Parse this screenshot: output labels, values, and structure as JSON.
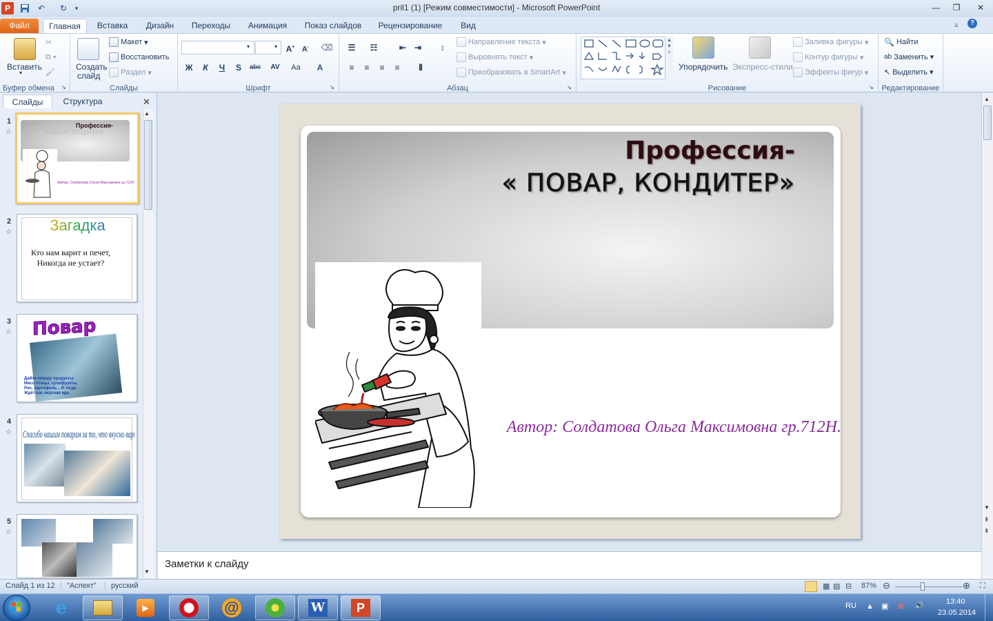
{
  "window": {
    "title": "pril1 (1) [Режим совместимости] - Microsoft PowerPoint"
  },
  "tabs": [
    "Файл",
    "Главная",
    "Вставка",
    "Дизайн",
    "Переходы",
    "Анимация",
    "Показ слайдов",
    "Рецензирование",
    "Вид"
  ],
  "ribbon": {
    "clipboard": {
      "paste": "Вставить",
      "group": "Буфер обмена"
    },
    "slides": {
      "new_slide_1": "Создать",
      "new_slide_2": "слайд",
      "layout": "Макет",
      "reset": "Восстановить",
      "section": "Раздел",
      "group": "Слайды"
    },
    "font": {
      "group": "Шрифт",
      "bold": "Ж",
      "italic": "К",
      "underline": "Ч",
      "shadow": "S",
      "strike": "abc",
      "spacing": "AV",
      "case": "Aa"
    },
    "paragraph": {
      "text_direction": "Направление текста",
      "align_text": "Выровнять текст",
      "smartart": "Преобразовать в SmartArt",
      "group": "Абзац"
    },
    "drawing": {
      "arrange": "Упорядочить",
      "quick_styles": "Экспресс-стили",
      "fill": "Заливка фигуры",
      "outline": "Контур фигуры",
      "effects": "Эффекты фигур",
      "group": "Рисование"
    },
    "editing": {
      "find": "Найти",
      "replace": "Заменить",
      "select": "Выделить",
      "group": "Редактирование"
    }
  },
  "panel": {
    "tabs": [
      "Слайды",
      "Структура"
    ],
    "thumbs": [
      {
        "num": "1",
        "title": "Профессия-",
        "subtitle": "« ПОВАР, КОНДИТЕР»",
        "author": "Автор: Солдатова Ольга Максимовна гр.712Н."
      },
      {
        "num": "2",
        "title": "Загадка",
        "line1": "Кто нам варит и печет,",
        "line2": "Никогда не устает?"
      },
      {
        "num": "3",
        "title": "Повар",
        "l1": "Дайте повару продукты:",
        "l2": "Мясо птицы, сухофрукты,",
        "l3": "Рис, картофель... И тогда",
        "l4": "Ждёт вас вкусная еда."
      },
      {
        "num": "4",
        "title": "Спасибо нашим поварам за то, что вкусно варят нам!"
      },
      {
        "num": "5"
      }
    ]
  },
  "slide": {
    "title": "Профессия-",
    "subtitle": "« ПОВАР, КОНДИТЕР»",
    "author": "Автор:  Солдатова Ольга Максимовна  гр.712Н."
  },
  "notes": {
    "placeholder": "Заметки к слайду"
  },
  "status": {
    "slide": "Слайд 1 из 12",
    "theme": "\"Аспект\"",
    "lang": "русский",
    "zoom": "87%"
  },
  "taskbar": {
    "lang": "RU",
    "time": "13:40",
    "date": "23.05.2014"
  },
  "colors": {
    "accent": "#e06415",
    "author": "#8a2a9a",
    "title": "#2b0d12"
  }
}
